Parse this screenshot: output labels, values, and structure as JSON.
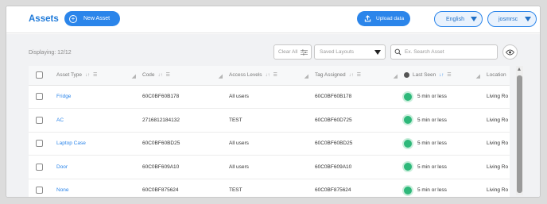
{
  "header": {
    "title": "Assets",
    "new_asset_label": "New Asset",
    "upload_label": "Upload data",
    "language": "English",
    "user": "josmrsc"
  },
  "toolbar": {
    "displaying": "Displaying: 12/12",
    "clear_all": "Clear All",
    "saved_layouts": "Saved Layouts",
    "search_placeholder": "Ex. Search Asset"
  },
  "table": {
    "headers": {
      "asset_type": "Asset Type",
      "code": "Code",
      "access_levels": "Access Levels",
      "tag_assigned": "Tag Assigned",
      "last_seen": "Last Seen",
      "location": "Location"
    },
    "rows": [
      {
        "asset_type": "Fridge",
        "code": "60C0BF60B178",
        "access": "All users",
        "tag": "60C0BF60B178",
        "last_seen": "5 min or less",
        "location": "Living Ro"
      },
      {
        "asset_type": "AC",
        "code": "2716812184132",
        "access": "TEST",
        "tag": "60C0BF60D725",
        "last_seen": "5 min or less",
        "location": "Living Ro"
      },
      {
        "asset_type": "Laptop Case",
        "code": "60C0BF60BD25",
        "access": "All users",
        "tag": "60C0BF60BD25",
        "last_seen": "5 min or less",
        "location": "Living Ro"
      },
      {
        "asset_type": "Door",
        "code": "60C0BF609A10",
        "access": "All users",
        "tag": "60C0BF609A10",
        "last_seen": "5 min or less",
        "location": "Living Ro"
      },
      {
        "asset_type": "None",
        "code": "60C0BF875624",
        "access": "TEST",
        "tag": "60C0BF875624",
        "last_seen": "5 min or less",
        "location": "Living Ro"
      }
    ]
  },
  "colors": {
    "accent": "#2b85ea",
    "status_online": "#2eb87a"
  }
}
